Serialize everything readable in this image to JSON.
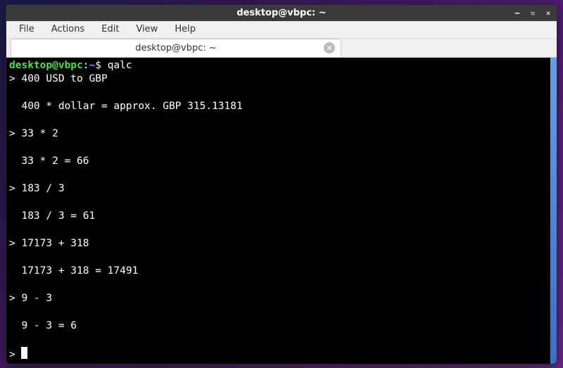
{
  "window": {
    "title": "desktop@vbpc: ~"
  },
  "menubar": {
    "items": [
      {
        "label": "File"
      },
      {
        "label": "Actions"
      },
      {
        "label": "Edit"
      },
      {
        "label": "View"
      },
      {
        "label": "Help"
      }
    ]
  },
  "tab": {
    "label": "desktop@vbpc: ~"
  },
  "prompt": {
    "user": "desktop",
    "at": "@",
    "host": "vbpc",
    "colon": ":",
    "path": "~",
    "symbol": "$ "
  },
  "terminal": {
    "command": "qalc",
    "lines": [
      "> 400 USD to GBP",
      "",
      "  400 * dollar = approx. GBP 315.13181",
      "",
      "> 33 * 2",
      "",
      "  33 * 2 = 66",
      "",
      "> 183 / 3",
      "",
      "  183 / 3 = 61",
      "",
      "> 17173 + 318",
      "",
      "  17173 + 318 = 17491",
      "",
      "> 9 - 3",
      "",
      "  9 - 3 = 6",
      ""
    ],
    "final_prompt": "> "
  }
}
